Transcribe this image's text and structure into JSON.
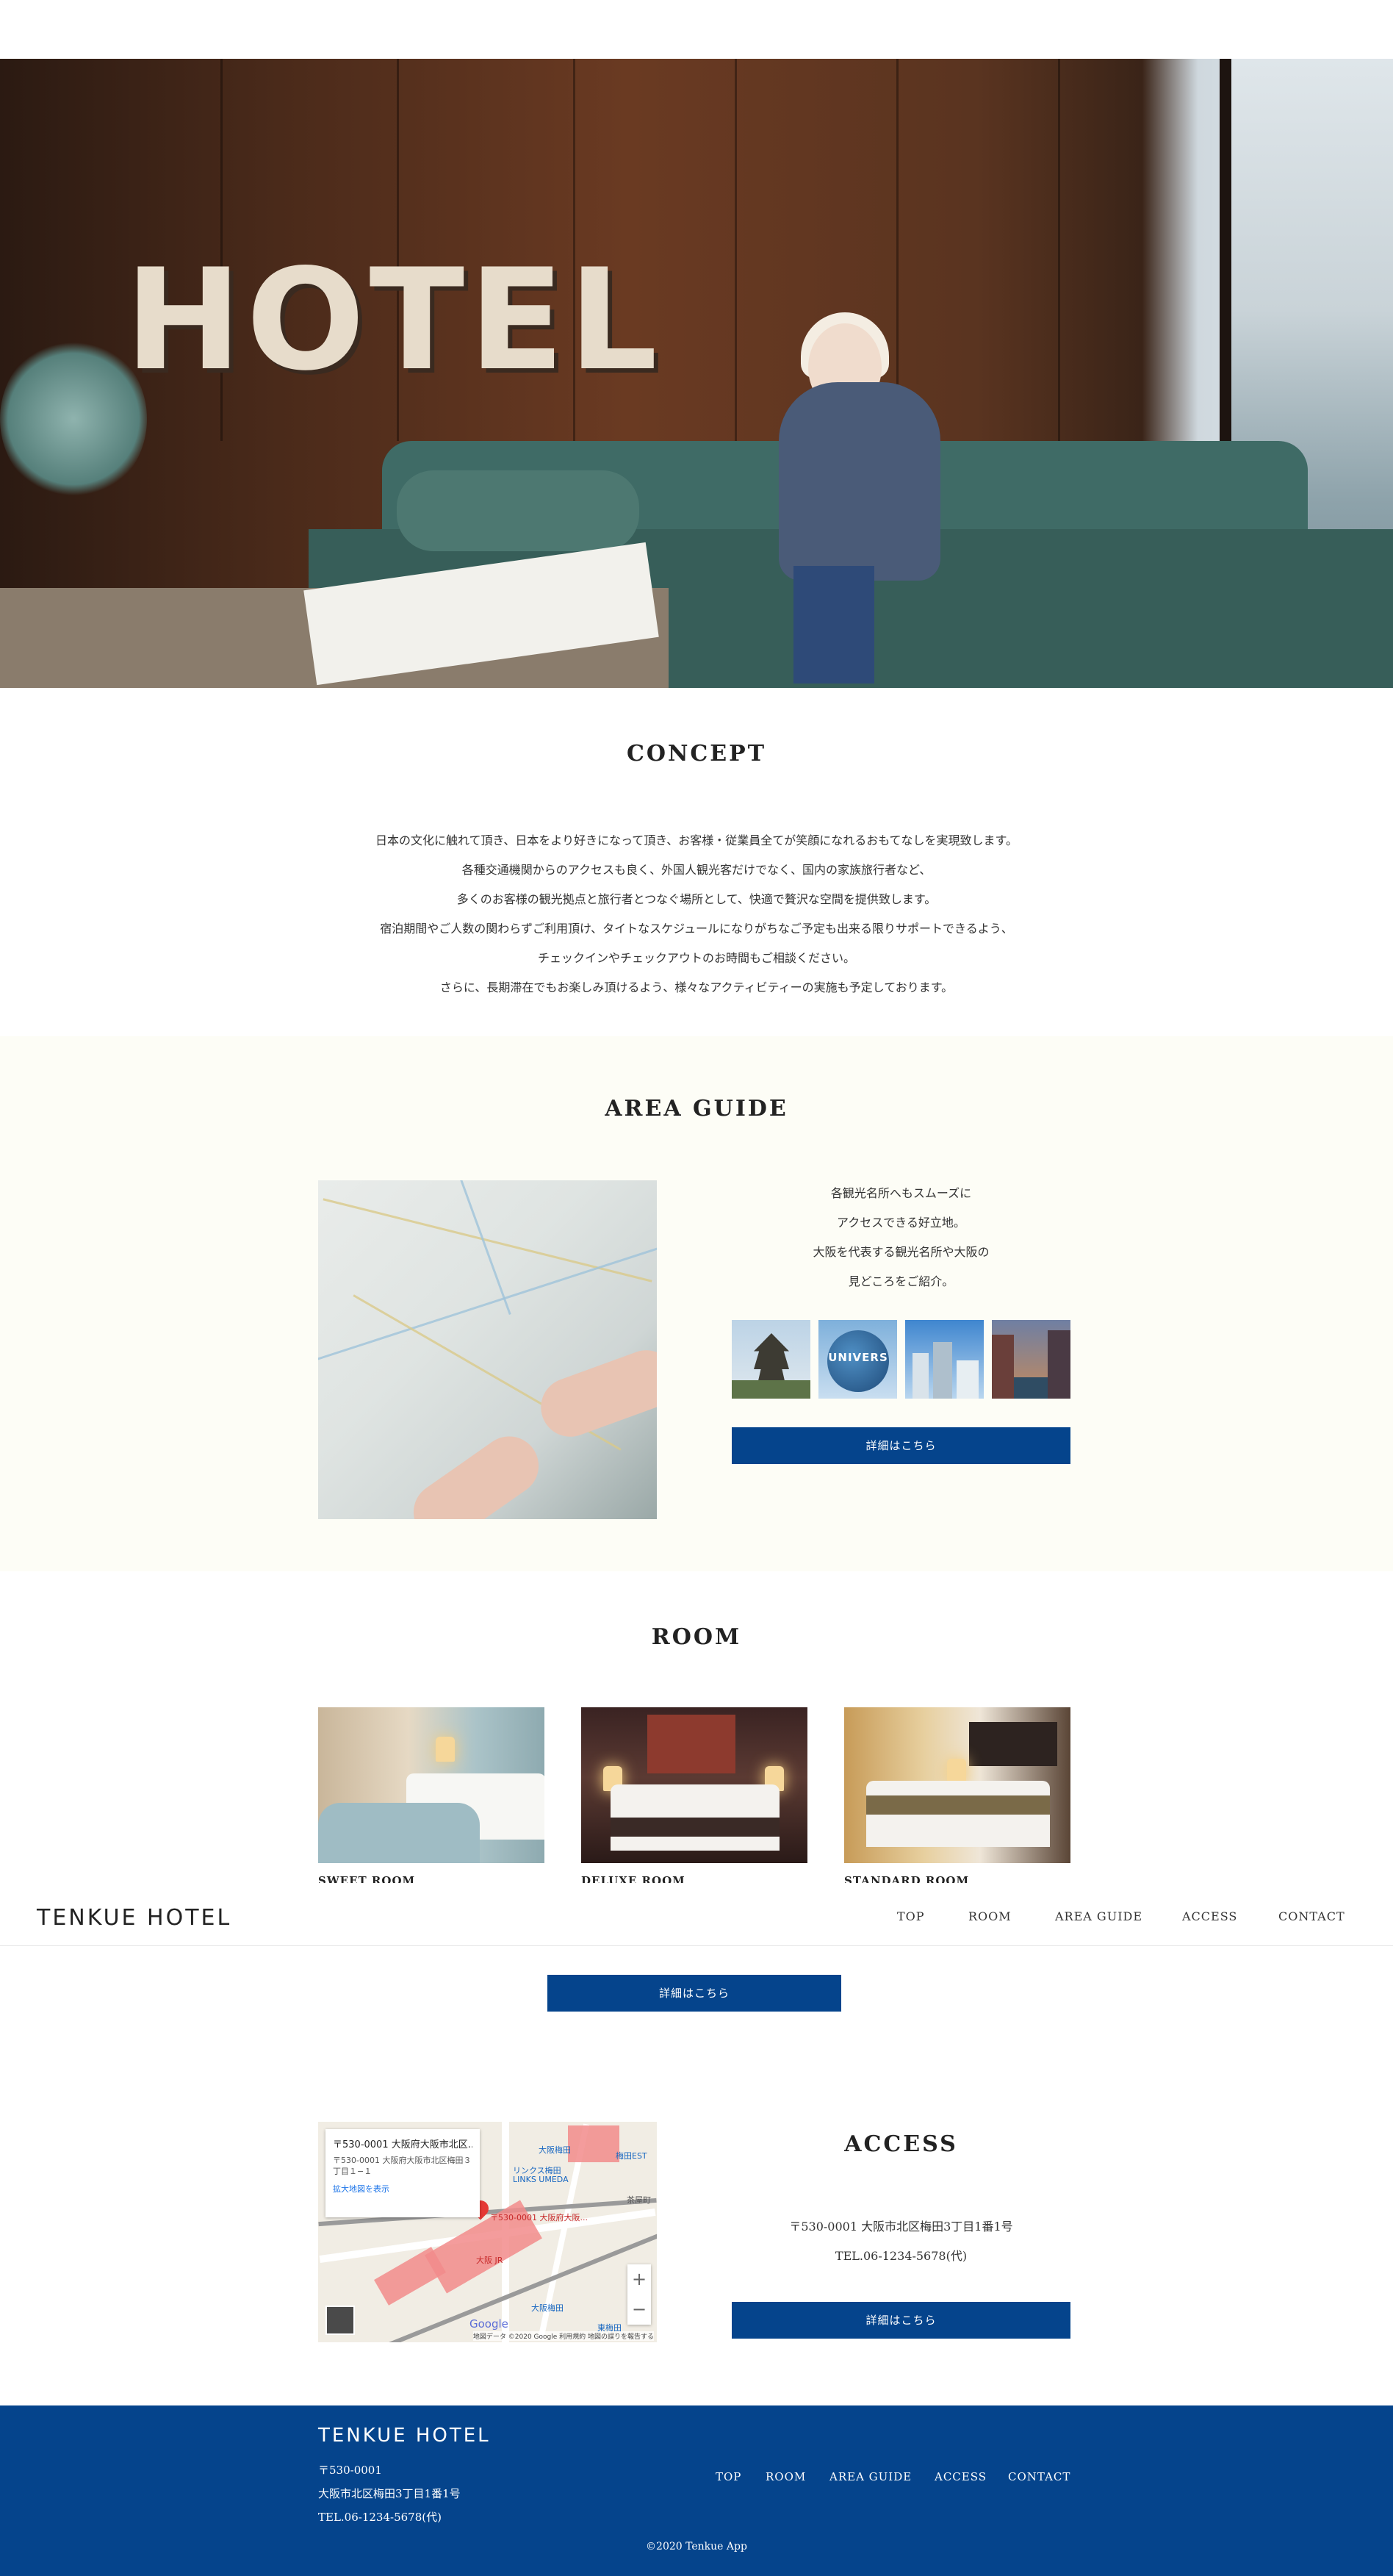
{
  "hero": {
    "sign_text": "HOTEL"
  },
  "concept": {
    "title": "CONCEPT",
    "lines": [
      "日本の文化に触れて頂き、日本をより好きになって頂き、お客様・従業員全てが笑顔になれるおもてなしを実現致します。",
      "各種交通機関からのアクセスも良く、外国人観光客だけでなく、国内の家族旅行者など、",
      "多くのお客様の観光拠点と旅行者とつなぐ場所として、快適で贅沢な空間を提供致します。",
      "宿泊期間やご人数の関わらずご利用頂け、タイトなスケジュールになりがちなご予定も出来る限りサポートできるよう、",
      "チェックインやチェックアウトのお時間もご相談ください。",
      "さらに、長期滞在でもお楽しみ頂けるよう、様々なアクティビティーの実施も予定しております。"
    ]
  },
  "area_guide": {
    "title": "AREA GUIDE",
    "lines": [
      "各観光名所へもスムーズに",
      "アクセスできる好立地。",
      "大阪を代表する観光名所や大阪の",
      "見どころをご紹介。"
    ],
    "thumb_text": "UNIVERS",
    "button": "詳細はこちら"
  },
  "room": {
    "title": "ROOM",
    "items": [
      {
        "name": "SWEET ROOM"
      },
      {
        "name": "DELUXE ROOM"
      },
      {
        "name": "STANDARD ROOM"
      }
    ],
    "button": "詳細はこちら"
  },
  "navbar": {
    "logo": "TENKUE HOTEL",
    "items": [
      "TOP",
      "ROOM",
      "AREA GUIDE",
      "ACCESS",
      "CONTACT"
    ]
  },
  "access": {
    "title": "ACCESS",
    "address": "〒530-0001 大阪市北区梅田3丁目1番1号",
    "tel": "TEL.06-1234-5678(代)",
    "button": "詳細はこちら",
    "map": {
      "info_title": "〒530-0001 大阪府大阪市北区...",
      "info_address": "〒530-0001 大阪府大阪市北区梅田３丁目１−１",
      "info_link": "拡大地図を表示",
      "pin_label": "〒530-0001 大阪府大阪...",
      "labels": [
        "大阪梅田",
        "梅田EST",
        "リンクス梅田",
        "LINKS UMEDA",
        "大阪 JR",
        "大阪梅田",
        "東梅田",
        "茶屋町"
      ],
      "zoom_in": "+",
      "zoom_out": "−",
      "google": "Google",
      "attribution": "地図データ ©2020 Google   利用規約   地図の誤りを報告する"
    }
  },
  "footer": {
    "logo": "TENKUE HOTEL",
    "postal": "〒530-0001",
    "address": "大阪市北区梅田3丁目1番1号",
    "tel": "TEL.06-1234-5678(代)",
    "nav": [
      "TOP",
      "ROOM",
      "AREA GUIDE",
      "ACCESS",
      "CONTACT"
    ],
    "copyright": "©2020 Tenkue App"
  }
}
